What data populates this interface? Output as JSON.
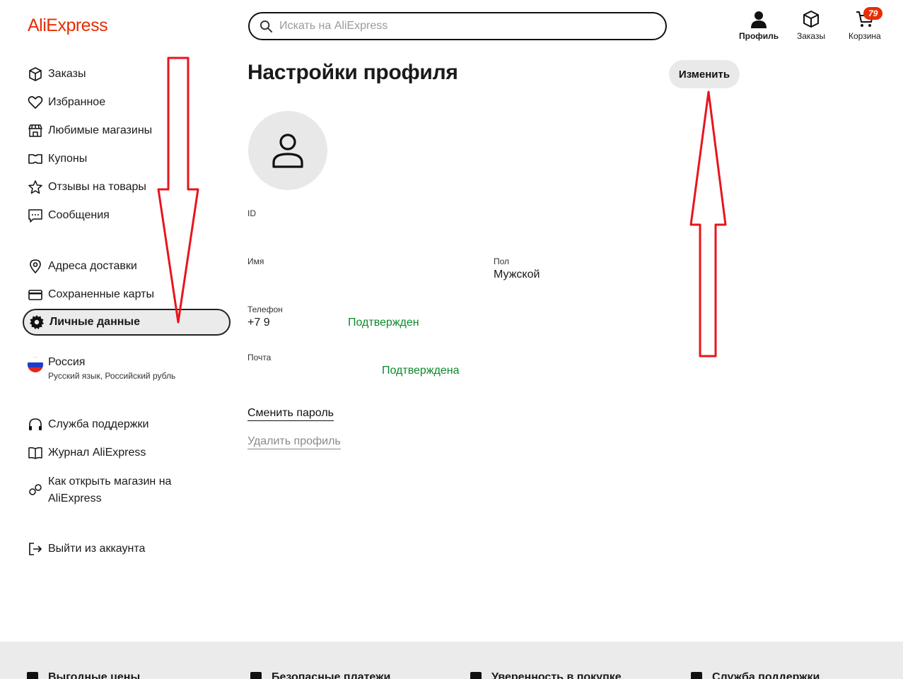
{
  "header": {
    "logo": "AliExpress",
    "search_placeholder": "Искать на AliExpress",
    "profile_label": "Профиль",
    "orders_label": "Заказы",
    "cart_label": "Корзина",
    "cart_count": "79"
  },
  "sidebar": {
    "items": [
      {
        "label": "Заказы",
        "icon": "box-icon"
      },
      {
        "label": "Избранное",
        "icon": "heart-icon"
      },
      {
        "label": "Любимые магазины",
        "icon": "store-icon"
      },
      {
        "label": "Купоны",
        "icon": "coupon-icon"
      },
      {
        "label": "Отзывы на товары",
        "icon": "star-icon"
      },
      {
        "label": "Сообщения",
        "icon": "chat-icon"
      },
      {
        "label": "Адреса доставки",
        "icon": "location-pin-icon"
      },
      {
        "label": "Сохраненные карты",
        "icon": "card-icon"
      },
      {
        "label": "Личные данные",
        "icon": "gear-icon",
        "active": true
      }
    ],
    "region": {
      "title": "Россия",
      "subtitle": "Русский язык, Российский рубль",
      "icon": "russia-flag-icon"
    },
    "support_items": [
      {
        "label": "Служба поддержки",
        "icon": "headphones-icon"
      },
      {
        "label": "Журнал AliExpress",
        "icon": "book-icon"
      },
      {
        "label": "Как открыть магазин на AliExpress",
        "icon": "link-icon"
      }
    ],
    "logout": {
      "label": "Выйти из аккаунта",
      "icon": "logout-icon"
    }
  },
  "main": {
    "title": "Настройки профиля",
    "edit_button": "Изменить",
    "fields": {
      "id_label": "ID",
      "name_label": "Имя",
      "gender_label": "Пол",
      "gender_value": "Мужской",
      "phone_label": "Телефон",
      "phone_value": "+7 9",
      "phone_status": "Подтвержден",
      "email_label": "Почта",
      "email_status": "Подтверждена"
    },
    "change_password": "Сменить пароль",
    "delete_profile": "Удалить профиль"
  },
  "footer": {
    "items": [
      "Выгодные цены",
      "Безопасные платежи",
      "Уверенность в покупке",
      "Служба поддержки"
    ]
  },
  "colors": {
    "brand": "#e62e04",
    "confirmed": "#0b8a2b",
    "annotation_arrow": "#e8141e"
  }
}
